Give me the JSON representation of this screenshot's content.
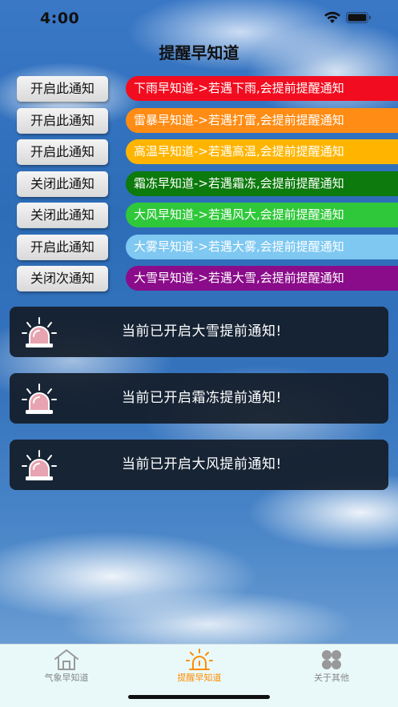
{
  "status_bar": {
    "time": "4:00"
  },
  "header": {
    "title": "提醒早知道"
  },
  "rules": [
    {
      "button": "开启此通知",
      "text": "下雨早知道->若遇下雨,会提前提醒通知",
      "color": "#f20c1f"
    },
    {
      "button": "开启此通知",
      "text": "雷暴早知道->若遇打雷,会提前提醒通知",
      "color": "#ff8c14"
    },
    {
      "button": "开启此通知",
      "text": "高温早知道->若遇高温,会提前提醒通知",
      "color": "#ffb500"
    },
    {
      "button": "关闭此通知",
      "text": "霜冻早知道->若遇霜冻,会提前提醒通知",
      "color": "#0c7a0c"
    },
    {
      "button": "关闭此通知",
      "text": "大风早知道->若遇风大,会提前提醒通知",
      "color": "#2fc83a"
    },
    {
      "button": "开启此通知",
      "text": "大雾早知道->若遇大雾,会提前提醒通知",
      "color": "#7ec8f2"
    },
    {
      "button": "关闭次通知",
      "text": "大雪早知道->若遇大雪,会提前提醒通知",
      "color": "#8a0c8a"
    }
  ],
  "notices": [
    {
      "icon": "alarm-light-icon",
      "text": "当前已开启大雪提前通知!"
    },
    {
      "icon": "alarm-light-icon",
      "text": "当前已开启霜冻提前通知!"
    },
    {
      "icon": "alarm-light-icon",
      "text": "当前已开启大风提前通知!"
    }
  ],
  "tabs": [
    {
      "label": "气象早知道",
      "icon": "house-icon",
      "active": false
    },
    {
      "label": "提醒早知道",
      "icon": "alarm-light-icon",
      "active": true
    },
    {
      "label": "关于其他",
      "icon": "grid-icon",
      "active": false
    }
  ],
  "colors": {
    "active_tab": "#ff8c00",
    "card_bg": "#141c28",
    "tab_bar_bg": "#e9f9f9"
  }
}
